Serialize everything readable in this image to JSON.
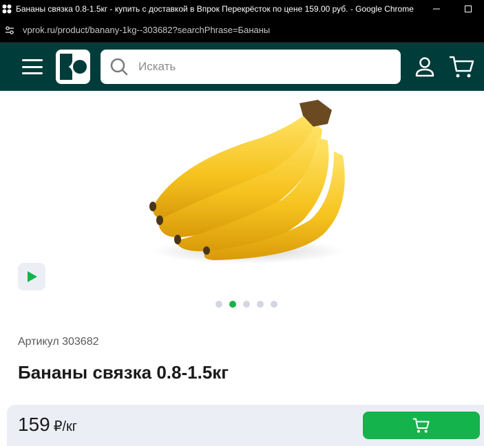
{
  "window": {
    "title": "Бананы связка 0.8-1.5кг - купить с доставкой в Впрок Перекрёсток по цене 159.00 руб. - Google Chrome"
  },
  "browser": {
    "url": "vprok.ru/product/banany-1kg--303682?searchPhrase=Бананы"
  },
  "header": {
    "search_placeholder": "Искать"
  },
  "product": {
    "article": "Артикул 303682",
    "title": "Бананы связка 0.8-1.5кг",
    "gallery_count": 5,
    "gallery_active_index": 1
  },
  "purchase": {
    "price": "159",
    "unit": "₽/кг"
  },
  "colors": {
    "header_bg": "#003c3a",
    "accent_green": "#15b34b",
    "bottom_bar_bg": "#eceef5"
  }
}
